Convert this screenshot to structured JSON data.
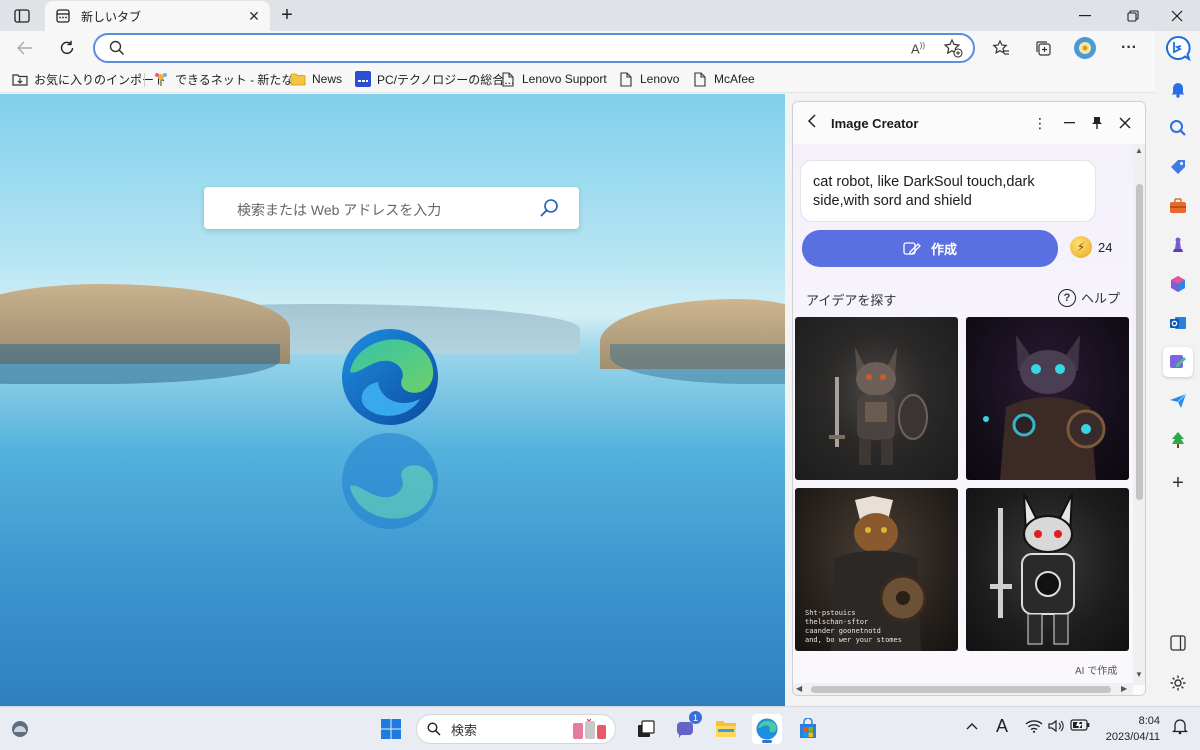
{
  "browser": {
    "tab_title": "新しいタブ",
    "new_tab_glyph": "+",
    "address_placeholder": "",
    "read_aloud": "A"
  },
  "favorites": [
    {
      "label": "お気に入りのインポート",
      "icon": "import-favorites-icon"
    },
    {
      "label": "できるネット - 新たな...",
      "icon": "dekiru-icon"
    },
    {
      "label": "News",
      "icon": "folder-icon"
    },
    {
      "label": "PC/テクノロジーの総合...",
      "icon": "pc-site-icon"
    },
    {
      "label": "Lenovo Support",
      "icon": "page-icon"
    },
    {
      "label": "Lenovo",
      "icon": "page-icon"
    },
    {
      "label": "McAfee",
      "icon": "page-icon"
    }
  ],
  "newtab": {
    "search_placeholder": "検索または Web アドレスを入力"
  },
  "image_creator": {
    "title": "Image Creator",
    "prompt": "cat robot, like DarkSoul touch,dark side,with sord and shield",
    "create_label": "作成",
    "boosts": "24",
    "ideas_label": "アイデアを探す",
    "help_label": "ヘルプ",
    "ai_generated_label": "AI で作成",
    "thumb_caption": "Sht·pstouics\nthelschan·sftor\ncaander goonetnotd\nand, bo wer your stomes"
  },
  "taskbar": {
    "search_label": "検索",
    "teams_badge": "1",
    "time": "8:04",
    "date": "2023/04/11",
    "ime": "A"
  },
  "colors": {
    "accent": "#5a6fe0",
    "address_border": "#5a8de0"
  }
}
